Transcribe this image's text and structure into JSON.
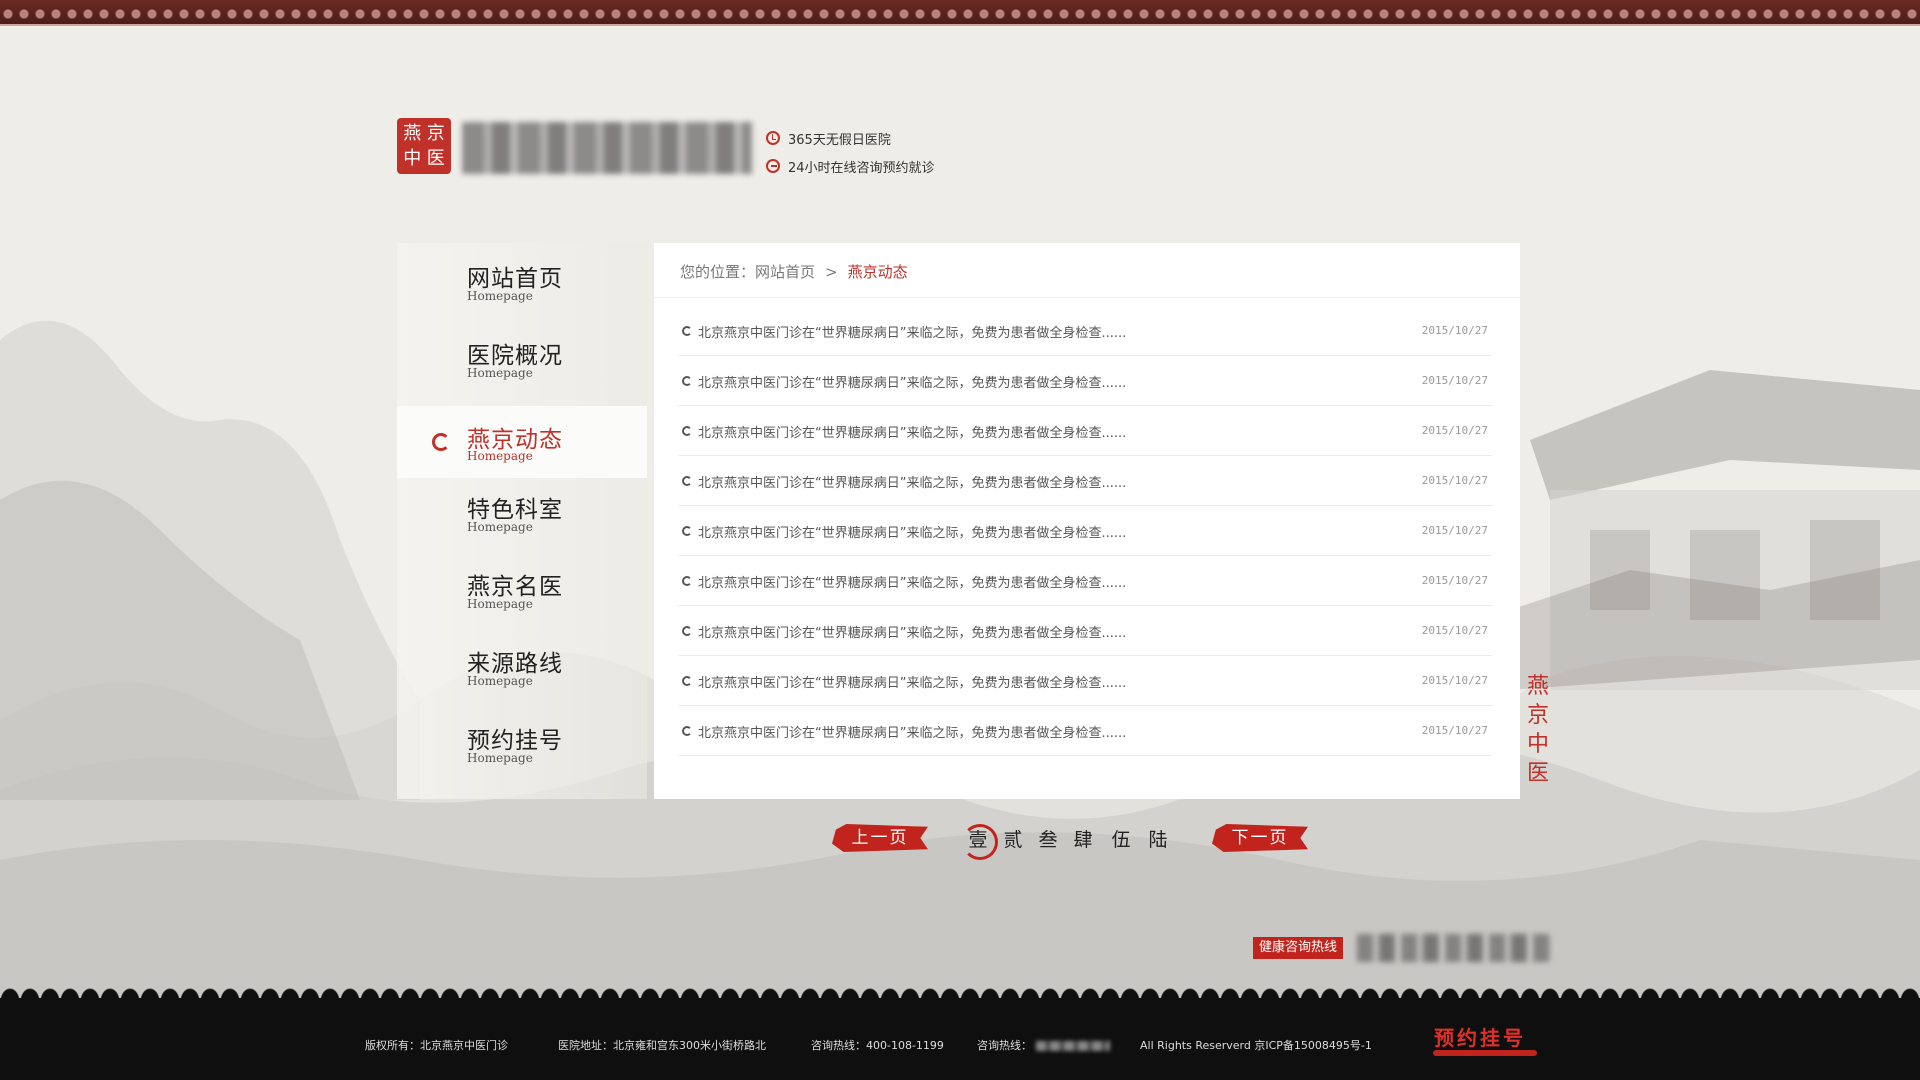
{
  "header": {
    "logo_seal_chars": [
      "燕",
      "京",
      "中",
      "医"
    ],
    "info": [
      {
        "icon": "clock-icon",
        "text": "365天无假日医院"
      },
      {
        "icon": "chat-icon",
        "text": "24小时在线咨询预约就诊"
      }
    ]
  },
  "sidebar": {
    "items": [
      {
        "title": "网站首页",
        "subtitle": "Homepage",
        "active": false
      },
      {
        "title": "医院概况",
        "subtitle": "Homepage",
        "active": false
      },
      {
        "title": "燕京动态",
        "subtitle": "Homepage",
        "active": true
      },
      {
        "title": "特色科室",
        "subtitle": "Homepage",
        "active": false
      },
      {
        "title": "燕京名医",
        "subtitle": "Homepage",
        "active": false
      },
      {
        "title": "来源路线",
        "subtitle": "Homepage",
        "active": false
      },
      {
        "title": "预约挂号",
        "subtitle": "Homepage",
        "active": false
      }
    ]
  },
  "breadcrumb": {
    "prefix": "您的位置：网站首页",
    "separator": ">",
    "current": "燕京动态"
  },
  "news": [
    {
      "title": "北京燕京中医门诊在“世界糖尿病日”来临之际，免费为患者做全身检查......",
      "date": "2015/10/27"
    },
    {
      "title": "北京燕京中医门诊在“世界糖尿病日”来临之际，免费为患者做全身检查......",
      "date": "2015/10/27"
    },
    {
      "title": "北京燕京中医门诊在“世界糖尿病日”来临之际，免费为患者做全身检查......",
      "date": "2015/10/27"
    },
    {
      "title": "北京燕京中医门诊在“世界糖尿病日”来临之际，免费为患者做全身检查......",
      "date": "2015/10/27"
    },
    {
      "title": "北京燕京中医门诊在“世界糖尿病日”来临之际，免费为患者做全身检查......",
      "date": "2015/10/27"
    },
    {
      "title": "北京燕京中医门诊在“世界糖尿病日”来临之际，免费为患者做全身检查......",
      "date": "2015/10/27"
    },
    {
      "title": "北京燕京中医门诊在“世界糖尿病日”来临之际，免费为患者做全身检查......",
      "date": "2015/10/27"
    },
    {
      "title": "北京燕京中医门诊在“世界糖尿病日”来临之际，免费为患者做全身检查......",
      "date": "2015/10/27"
    },
    {
      "title": "北京燕京中医门诊在“世界糖尿病日”来临之际，免费为患者做全身检查......",
      "date": "2015/10/27"
    }
  ],
  "side_seal": "燕京中医",
  "pagination": {
    "prev_label": "上一页",
    "next_label": "下一页",
    "pages": [
      "壹",
      "贰",
      "叁",
      "肆",
      "伍",
      "陆"
    ],
    "current_page": 1
  },
  "hotline": {
    "label": "健康咨询热线"
  },
  "footer": {
    "copyright": "版权所有：北京燕京中医门诊",
    "address": "医院地址：北京雍和宫东300米小街桥路北",
    "phone1": "咨询热线：400-108-1199",
    "phone2_label": "咨询热线：",
    "rights": "All Rights Reserverd 京ICP备15008495号-1",
    "appointment_label": "预约挂号"
  },
  "colors": {
    "accent": "#c0312a",
    "footer_bg": "#0f0f0f",
    "page_bg": "#efede8"
  }
}
